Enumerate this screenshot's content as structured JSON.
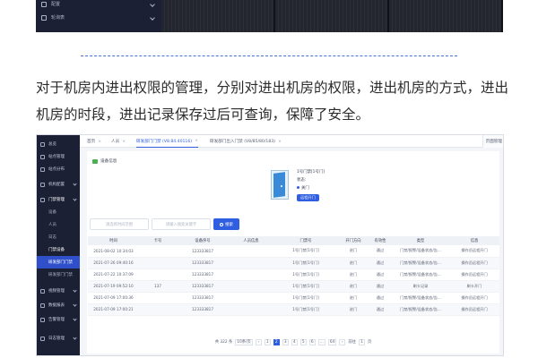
{
  "top_sidebar": [
    "配置",
    "轮询表"
  ],
  "paragraph": "对于机房内进出权限的管理，分别对进出机房的权限，进出机房的方式，进出机房的时段，进出记录保存过后可查询，保障了安全。",
  "sidebar": {
    "items": [
      "总览",
      "站点管理",
      "站点分布",
      "机构配置",
      "门禁管理",
      "设备",
      "人员",
      "日志",
      "门禁设备",
      "研发部门门禁",
      "研发部门门禁",
      "视频管理",
      "数据报表",
      "告警管理",
      "日志管理"
    ]
  },
  "tabs": [
    {
      "label": "首页"
    },
    {
      "label": "人员"
    },
    {
      "label": "研发部门门禁 (V8.84.40116)"
    },
    {
      "label": "研发部门出入门禁 (V8/85/80/183)"
    }
  ],
  "tab_right": "页面管理",
  "device": {
    "title": "设备信息",
    "door_name": "1号门禁[1号门]",
    "status_1": "状态:",
    "status_2": "关门",
    "open_button": "远程开门"
  },
  "filters": {
    "card_placeholder": "请选择时间范围",
    "person_placeholder": "请输入搜索关键字",
    "search_label": "搜索"
  },
  "table": {
    "columns": [
      "时间",
      "卡号",
      "设备序号",
      "人员信息",
      "门禁号",
      "开门方向",
      "有效性",
      "类型",
      "信息"
    ],
    "rows": [
      [
        "2021-08-02 10:34:03",
        "",
        "123333817",
        "",
        "1号门禁[1号门]",
        "进门",
        "通过",
        "门禁/报警/设备状态/告...",
        "操作员远程开门"
      ],
      [
        "2021-07-26 09:40:16",
        "",
        "123333817",
        "",
        "1号门禁[1号门]",
        "进门",
        "通过",
        "门禁/报警/设备状态/告...",
        "操作员远程开门"
      ],
      [
        "2021-07-22 10:37:09",
        "",
        "123333817",
        "",
        "1号门禁[1号门]",
        "进门",
        "通过",
        "门禁/报警/设备状态/告...",
        "操作员远程开门"
      ],
      [
        "2021-07-19 09:52:10",
        "137",
        "123333817",
        "",
        "1号门禁[1号门]",
        "进门",
        "通过",
        "刷卡记录",
        "刷卡开门"
      ],
      [
        "2021-07-09 17:00:36",
        "",
        "123333817",
        "",
        "1号门禁[1号门]",
        "进门",
        "通过",
        "门禁/报警/设备状态/告...",
        "操作员远程开门"
      ],
      [
        "2021-07-09 17:00:21",
        "",
        "123333817",
        "",
        "1号门禁[1号门]",
        "进门",
        "通过",
        "门禁/报警/设备状态/告...",
        "操作员远程开门"
      ]
    ]
  },
  "pagination": {
    "total": "共 322 条",
    "size": "10条/页",
    "pages": [
      "1",
      "2",
      "3",
      "4",
      "5",
      "6",
      "...",
      "64"
    ],
    "prev": "‹",
    "next": "›",
    "goto": "前往",
    "goto_value": "1",
    "goto_suffix": "页",
    "current": 2
  },
  "colors": {
    "accent": "#2f5fe0",
    "sidebar_bg": "#1c2034",
    "divider": "#4b6fd6"
  }
}
